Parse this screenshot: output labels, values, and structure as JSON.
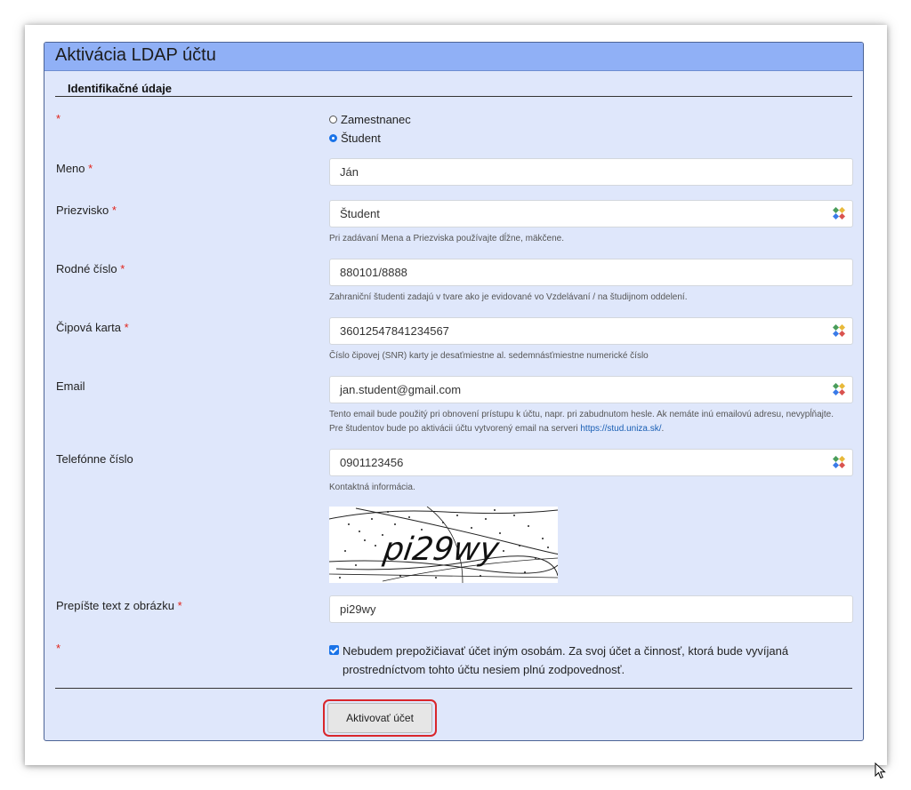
{
  "form": {
    "title": "Aktivácia LDAP účtu",
    "section_title": "Identifikačné údaje",
    "required_mark": "*",
    "account_type": {
      "options": [
        "Zamestnanec",
        "Študent"
      ],
      "selected": "Študent"
    },
    "fields": {
      "meno": {
        "label": "Meno",
        "value": "Ján"
      },
      "priezvisko": {
        "label": "Priezvisko",
        "value": "Študent",
        "help": "Pri zadávaní Mena a Priezviska používajte dĺžne, mäkčene."
      },
      "rodne_cislo": {
        "label": "Rodné číslo",
        "value": "880101/8888",
        "help": "Zahraniční študenti zadajú v tvare ako je evidované vo Vzdelávaní / na študijnom oddelení."
      },
      "cipova_karta": {
        "label": "Čipová karta",
        "value": "36012547841234567",
        "help": "Číslo čipovej (SNR) karty je desaťmiestne al. sedemnásťmiestne numerické číslo"
      },
      "email": {
        "label": "Email",
        "value": "jan.student@gmail.com",
        "help": "Tento email bude použitý pri obnovení prístupu k účtu, napr. pri zabudnutom hesle. Ak nemáte inú emailovú adresu, nevypĺňajte. Pre študentov bude po aktivácii účtu vytvorený email na serveri",
        "help_link": "https://stud.uniza.sk/",
        "help_end": "."
      },
      "telefon": {
        "label": "Telefónne číslo",
        "value": "0901123456",
        "help": "Kontaktná informácia."
      },
      "captcha_text": {
        "label": "Prepíšte text z obrázku",
        "value": "pi29wy"
      }
    },
    "captcha_image_text": "pi29wy",
    "agreement": {
      "checked": true,
      "text": "Nebudem prepožičiavať účet iným osobám. Za svoj účet a činnosť, ktorá bude vyvíjaná prostredníctvom tohto účtu nesiem plnú zodpovednosť."
    },
    "submit_label": "Aktivovať účet"
  },
  "icons": {
    "password_manager": "password-manager-icon",
    "cursor": "mouse-cursor-icon"
  },
  "colors": {
    "header_bg": "#90b0f6",
    "panel_bg": "#dfe7fb",
    "required": "#e0231a",
    "highlight": "#d9262b",
    "accent": "#1a73e8"
  }
}
